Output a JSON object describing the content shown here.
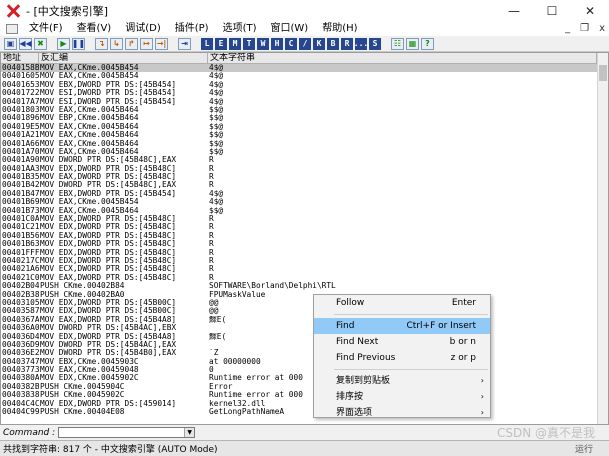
{
  "window": {
    "title": "- [中文搜索引擎]",
    "minimize": "—",
    "maximize": "☐",
    "close": "✕"
  },
  "menubar": {
    "items": [
      "文件(F)",
      "查看(V)",
      "调试(D)",
      "插件(P)",
      "选项(T)",
      "窗口(W)",
      "帮助(H)"
    ],
    "mdi_min": "_",
    "mdi_restore": "❐",
    "mdi_close": "x"
  },
  "toolbar": {
    "buttons": [
      "▣",
      "◀◀",
      "✖",
      "▶",
      "❚❚",
      "↴",
      "↳",
      "↱",
      "↦",
      "→|",
      "⇥"
    ],
    "letters": [
      "L",
      "E",
      "M",
      "T",
      "W",
      "H",
      "C",
      "/",
      "K",
      "B",
      "R",
      "...",
      "S"
    ],
    "tail": [
      "☷",
      "▦",
      "?"
    ]
  },
  "panel": {
    "headers": {
      "address": "地址",
      "disasm": "反汇编",
      "text": "文本字符串"
    }
  },
  "rows": [
    {
      "addr": "0040158B",
      "asm": "MOV EAX,CKme.0045B454",
      "str": "4$@",
      "sel": true
    },
    {
      "addr": "00401605",
      "asm": "MOV EAX,CKme.0045B454",
      "str": "4$@"
    },
    {
      "addr": "00401653",
      "asm": "MOV EBX,DWORD PTR DS:[45B454]",
      "str": "4$@"
    },
    {
      "addr": "00401722",
      "asm": "MOV ESI,DWORD PTR DS:[45B454]",
      "str": "4$@"
    },
    {
      "addr": "004017A7",
      "asm": "MOV ESI,DWORD PTR DS:[45B454]",
      "str": "4$@"
    },
    {
      "addr": "00401803",
      "asm": "MOV EAX,CKme.0045B464",
      "str": "$$@"
    },
    {
      "addr": "00401896",
      "asm": "MOV EBP,CKme.0045B464",
      "str": "$$@"
    },
    {
      "addr": "004019E5",
      "asm": "MOV EAX,CKme.0045B464",
      "str": "$$@"
    },
    {
      "addr": "00401A21",
      "asm": "MOV EAX,CKme.0045B464",
      "str": "$$@"
    },
    {
      "addr": "00401A66",
      "asm": "MOV EAX,CKme.0045B464",
      "str": "$$@"
    },
    {
      "addr": "00401A70",
      "asm": "MOV EAX,CKme.0045B464",
      "str": "$$@"
    },
    {
      "addr": "00401A90",
      "asm": "MOV DWORD PTR DS:[45B48C],EAX",
      "str": "R"
    },
    {
      "addr": "00401AA3",
      "asm": "MOV EDX,DWORD PTR DS:[45B48C]",
      "str": "R"
    },
    {
      "addr": "00401B35",
      "asm": "MOV EAX,DWORD PTR DS:[45B48C]",
      "str": "R"
    },
    {
      "addr": "00401B42",
      "asm": "MOV DWORD PTR DS:[45B48C],EAX",
      "str": "R"
    },
    {
      "addr": "00401B47",
      "asm": "MOV EBX,DWORD PTR DS:[45B454]",
      "str": "4$@"
    },
    {
      "addr": "00401B69",
      "asm": "MOV EAX,CKme.0045B454",
      "str": "4$@"
    },
    {
      "addr": "00401B73",
      "asm": "MOV EAX,CKme.0045B464",
      "str": "$$@"
    },
    {
      "addr": "00401C0A",
      "asm": "MOV EAX,DWORD PTR DS:[45B48C]",
      "str": "R"
    },
    {
      "addr": "00401C21",
      "asm": "MOV EDX,DWORD PTR DS:[45B48C]",
      "str": "R"
    },
    {
      "addr": "00401B56",
      "asm": "MOV EAX,DWORD PTR DS:[45B48C]",
      "str": "R"
    },
    {
      "addr": "00401B63",
      "asm": "MOV EDX,DWORD PTR DS:[45B48C]",
      "str": "R"
    },
    {
      "addr": "00401FFF",
      "asm": "MOV EDX,DWORD PTR DS:[45B48C]",
      "str": "R"
    },
    {
      "addr": "0040217C",
      "asm": "MOV EDX,DWORD PTR DS:[45B48C]",
      "str": "R"
    },
    {
      "addr": "004021A6",
      "asm": "MOV ECX,DWORD PTR DS:[45B48C]",
      "str": "R"
    },
    {
      "addr": "004021C0",
      "asm": "MOV EAX,DWORD PTR DS:[45B48C]",
      "str": "R"
    },
    {
      "addr": "00402B04",
      "asm": "PUSH CKme.00402B84",
      "str": "SOFTWARE\\Borland\\Delphi\\RTL"
    },
    {
      "addr": "00402B38",
      "asm": "PUSH CKme.00402BA0",
      "str": "FPUMaskValue"
    },
    {
      "addr": "00403105",
      "asm": "MOV EDX,DWORD PTR DS:[45B00C]",
      "str": "@@"
    },
    {
      "addr": "00403587",
      "asm": "MOV EDX,DWORD PTR DS:[45B00C]",
      "str": "@@"
    },
    {
      "addr": "0040367A",
      "asm": "MOV EAX,DWORD PTR DS:[45B4A8]",
      "str": "鰥E("
    },
    {
      "addr": "004036A0",
      "asm": "MOV DWORD PTR DS:[45B4AC],EBX",
      "str": ""
    },
    {
      "addr": "004036D4",
      "asm": "MOV EDX,DWORD PTR DS:[45B4A8]",
      "str": "鰥E("
    },
    {
      "addr": "004036D9",
      "asm": "MOV DWORD PTR DS:[45B4AC],EAX",
      "str": ""
    },
    {
      "addr": "004036E2",
      "asm": "MOV DWORD PTR DS:[45B4B0],EAX",
      "str": "`Z"
    },
    {
      "addr": "00403747",
      "asm": "MOV EBX,CKme.0045903C",
      "str": "  at 00000000"
    },
    {
      "addr": "00403773",
      "asm": "MOV EAX,CKme.00459048",
      "str": "0"
    },
    {
      "addr": "0040380A",
      "asm": "MOV EDX,CKme.0045902C",
      "str": "Runtime error     at 000"
    },
    {
      "addr": "0040382B",
      "asm": "PUSH CKme.0045904C",
      "str": "Error"
    },
    {
      "addr": "00403838",
      "asm": "PUSH CKme.0045902C",
      "str": "Runtime error     at 000"
    },
    {
      "addr": "00404C4C",
      "asm": "MOV EDX,DWORD PTR DS:[459014]",
      "str": "kernel32.dll"
    },
    {
      "addr": "00404C99",
      "asm": "PUSH CKme.00404E08",
      "str": "GetLongPathNameA"
    }
  ],
  "context_menu": {
    "items": [
      {
        "label": "Follow",
        "shortcut": "Enter",
        "group": 1
      },
      {
        "label": "Find",
        "shortcut": "Ctrl+F or Insert",
        "group": 2,
        "highlighted": true
      },
      {
        "label": "Find Next",
        "shortcut": "b or n",
        "group": 2
      },
      {
        "label": "Find Previous",
        "shortcut": "z or p",
        "group": 2
      },
      {
        "label": "复制到剪贴板",
        "submenu": true,
        "group": 3
      },
      {
        "label": "排序按",
        "submenu": true,
        "group": 3
      },
      {
        "label": "界面选项",
        "submenu": true,
        "group": 3
      }
    ]
  },
  "command": {
    "label": "Command :",
    "value": "",
    "dropdown_icon": "▼"
  },
  "status": {
    "text": "共找到字符串: 817 个 - 中文搜索引擎 (AUTO Mode)",
    "state": "运行"
  },
  "watermark": "CSDN @真不是我",
  "colors": {
    "selection": "#c8c8c8",
    "menu_highlight": "#91c9f7",
    "toolbar_letter_bg": "#26478f",
    "close_icon": "#d4202a"
  }
}
